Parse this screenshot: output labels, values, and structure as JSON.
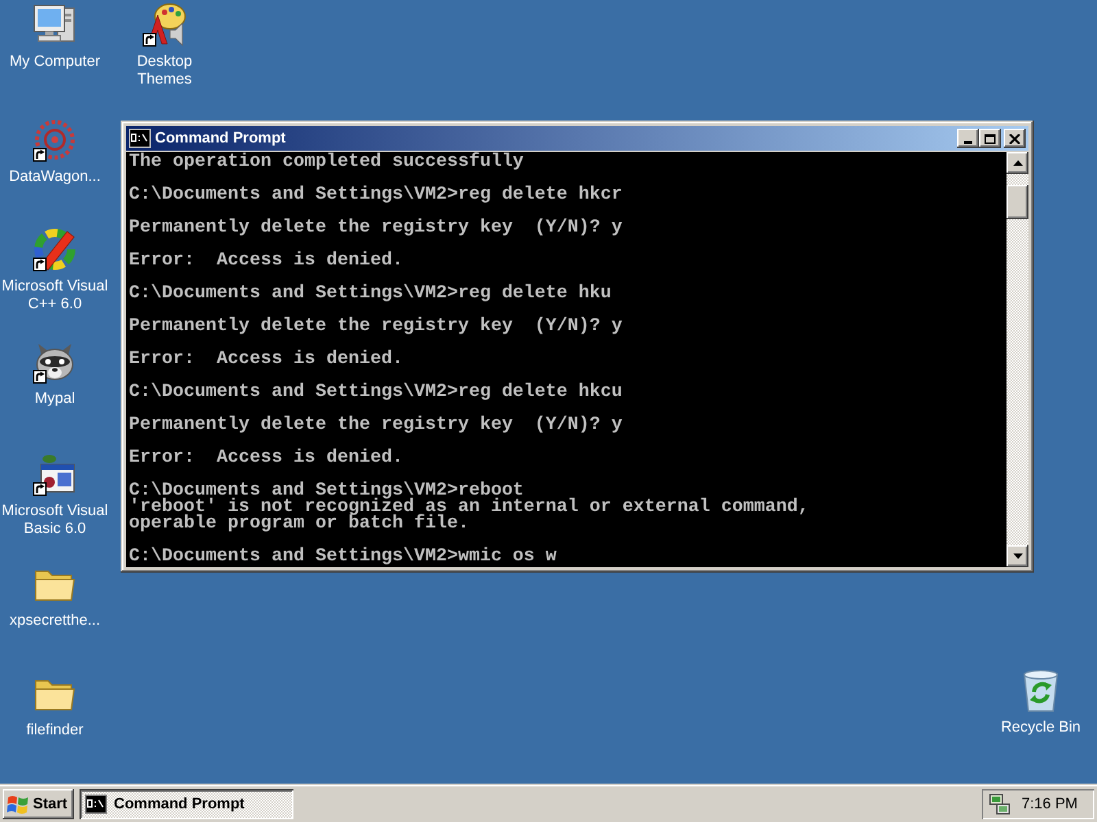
{
  "desktop_icons": [
    {
      "label": "My Computer",
      "kind": "computer",
      "shortcut": false
    },
    {
      "label": "Desktop Themes",
      "kind": "themes",
      "shortcut": true
    },
    {
      "label": "DataWagon...",
      "kind": "target",
      "shortcut": true
    },
    {
      "label": "Microsoft Visual C++ 6.0",
      "kind": "wheel",
      "shortcut": true
    },
    {
      "label": "Mypal",
      "kind": "raccoon",
      "shortcut": true
    },
    {
      "label": "Microsoft Visual Basic 6.0",
      "kind": "vb",
      "shortcut": true
    },
    {
      "label": "xpsecretthe...",
      "kind": "folder",
      "shortcut": false
    },
    {
      "label": "filefinder",
      "kind": "folder",
      "shortcut": false
    },
    {
      "label": "Recycle Bin",
      "kind": "recycle-bin",
      "shortcut": false
    }
  ],
  "window": {
    "title": "Command Prompt",
    "console_blocks": [
      [
        "The operation completed successfully"
      ],
      [
        "C:\\Documents and Settings\\VM2>reg delete hkcr"
      ],
      [
        "Permanently delete the registry key  (Y/N)? y"
      ],
      [
        "Error:  Access is denied."
      ],
      [
        "C:\\Documents and Settings\\VM2>reg delete hku"
      ],
      [
        "Permanently delete the registry key  (Y/N)? y"
      ],
      [
        "Error:  Access is denied."
      ],
      [
        "C:\\Documents and Settings\\VM2>reg delete hkcu"
      ],
      [
        "Permanently delete the registry key  (Y/N)? y"
      ],
      [
        "Error:  Access is denied."
      ],
      [
        "C:\\Documents and Settings\\VM2>reboot",
        "'reboot' is not recognized as an internal or external command,",
        "operable program or batch file."
      ],
      [
        "C:\\Documents and Settings\\VM2>wmic os w"
      ]
    ]
  },
  "taskbar": {
    "start": "Start",
    "buttons": [
      {
        "label": "Command Prompt",
        "selected": true
      }
    ],
    "clock": "7:16 PM"
  }
}
